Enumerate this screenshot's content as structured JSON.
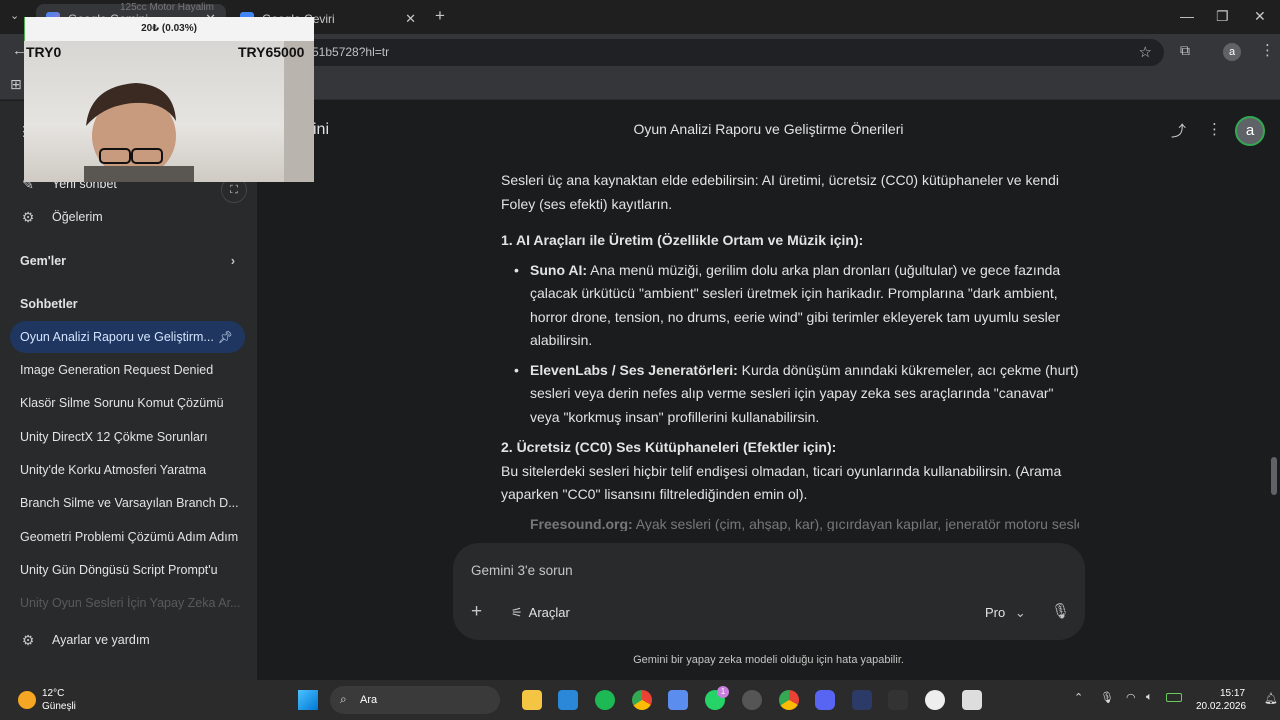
{
  "browser": {
    "tabs": [
      {
        "label": "Google Gemini",
        "active": true
      },
      {
        "label": "Google Çeviri",
        "active": false
      }
    ],
    "new_tab": "+",
    "url": "51b5728?hl=tr"
  },
  "overlay": {
    "banner_text": "125cc Motor Hayalim",
    "progress_text": "20₺ (0.03%)",
    "progress_fraction": 0.0003,
    "min_label": "TRY0",
    "max_label": "TRY65000"
  },
  "sidebar": {
    "brand_partial": "ini",
    "new_chat": "Yeni sohbet",
    "my_items": "Öğelerim",
    "gems_heading": "Gem'ler",
    "chats_heading": "Sohbetler",
    "chats": [
      {
        "label": "Oyun Analizi Raporu ve Geliştirm...",
        "active": true,
        "pinned": true
      },
      {
        "label": "Image Generation Request Denied"
      },
      {
        "label": "Klasör Silme Sorunu Komut Çözümü"
      },
      {
        "label": "Unity DirectX 12 Çökme Sorunları"
      },
      {
        "label": "Unity'de Korku Atmosferi Yaratma"
      },
      {
        "label": "Branch Silme ve Varsayılan Branch D..."
      },
      {
        "label": "Geometri Problemi Çözümü Adım Adım"
      },
      {
        "label": "Unity Gün Döngüsü Script Prompt'u"
      },
      {
        "label": "Unity Oyun Sesleri İçin Yapay Zeka Ar..."
      }
    ],
    "settings": "Ayarlar ve yardım"
  },
  "main": {
    "title": "Oyun Analizi Raporu ve Geliştirme Önerileri",
    "avatar_letter": "a",
    "intro": "Sesleri üç ana kaynaktan elde edebilirsin: AI üretimi, ücretsiz (CC0) kütüphaneler ve kendi Foley (ses efekti) kayıtların.",
    "section1_heading": "1. AI Araçları ile Üretim (Özellikle Ortam ve Müzik için):",
    "section1_items": [
      {
        "term": "Suno AI:",
        "text": " Ana menü müziği, gerilim dolu arka plan dronları (uğultular) ve gece fazında çalacak ürkütücü \"ambient\" sesleri üretmek için harikadır. Promplarına \"dark ambient, horror drone, tension, no drums, eerie wind\" gibi terimler ekleyerek tam uyumlu sesler alabilirsin."
      },
      {
        "term": "ElevenLabs / Ses Jeneratörleri:",
        "text": " Kurda dönüşüm anındaki kükremeler, acı çekme (hurt) sesleri veya derin nefes alıp verme sesleri için yapay zeka ses araçlarında \"canavar\" veya \"korkmuş insan\" profillerini kullanabilirsin."
      }
    ],
    "section2_heading": "2. Ücretsiz (CC0) Ses Kütüphaneleri (Efektler için):",
    "section2_intro": "Bu sitelerdeki sesleri hiçbir telif endişesi olmadan, ticari oyunlarında kullanabilirsin. (Arama yaparken \"CC0\" lisansını filtrelediğinden emin ol).",
    "section2_items": [
      {
        "term": "Freesound.org:",
        "text": " Ayak sesleri (çim, ahşap, kar), gıcırdayan kapılar, jeneratör motoru sesleri"
      }
    ],
    "composer_placeholder": "Gemini 3'e sorun",
    "tools_label": "Araçlar",
    "model_label": "Pro",
    "disclaimer": "Gemini bir yapay zeka modeli olduğu için hata yapabilir."
  },
  "taskbar": {
    "weather_temp": "12°C",
    "weather_desc": "Güneşli",
    "search_label": "Ara",
    "time": "15:17",
    "date": "20.02.2026",
    "badges": {
      "whatsapp": "1"
    }
  }
}
